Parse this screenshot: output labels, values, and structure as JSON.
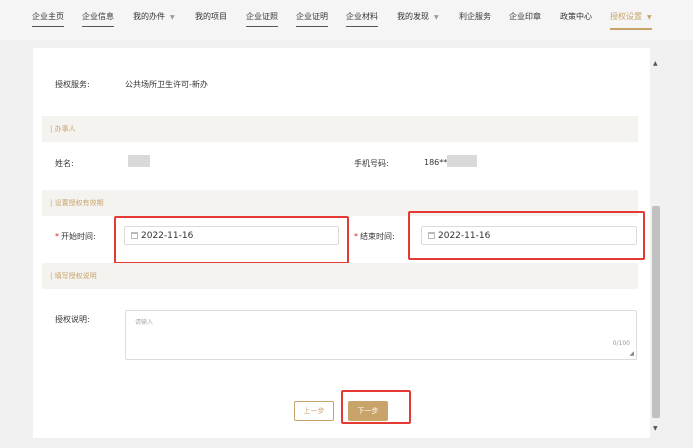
{
  "nav": {
    "items": [
      {
        "label": "企业主页"
      },
      {
        "label": "企业信息"
      },
      {
        "label": "我的办件"
      },
      {
        "label": "我的项目"
      },
      {
        "label": "企业证照"
      },
      {
        "label": "企业证明"
      },
      {
        "label": "企业材料"
      },
      {
        "label": "我的发现"
      },
      {
        "label": "利企服务"
      },
      {
        "label": "企业印章"
      },
      {
        "label": "政策中心"
      },
      {
        "label": "授权设置"
      }
    ],
    "active_item": "授权设置",
    "accent_color": "#c8a46a"
  },
  "form": {
    "service_label": "授权服务:",
    "service_value": "公共场所卫生许可-新办",
    "handler_section": "办事人",
    "name_label": "姓名:",
    "name_value": "",
    "phone_label": "手机号码:",
    "phone_value": "186**",
    "validity_section": "设置授权有效期",
    "required_mark": "*",
    "start_label": "开始时间:",
    "start_value": "2022-11-16",
    "end_label": "结束时间:",
    "end_value": "2022-11-16",
    "desc_section": "填写授权说明",
    "desc_label": "授权说明:",
    "desc_placeholder": "请输入",
    "desc_counter": "0/100"
  },
  "buttons": {
    "prev_label": "上一步",
    "next_label": "下一步"
  },
  "highlight_color": "#e53935"
}
